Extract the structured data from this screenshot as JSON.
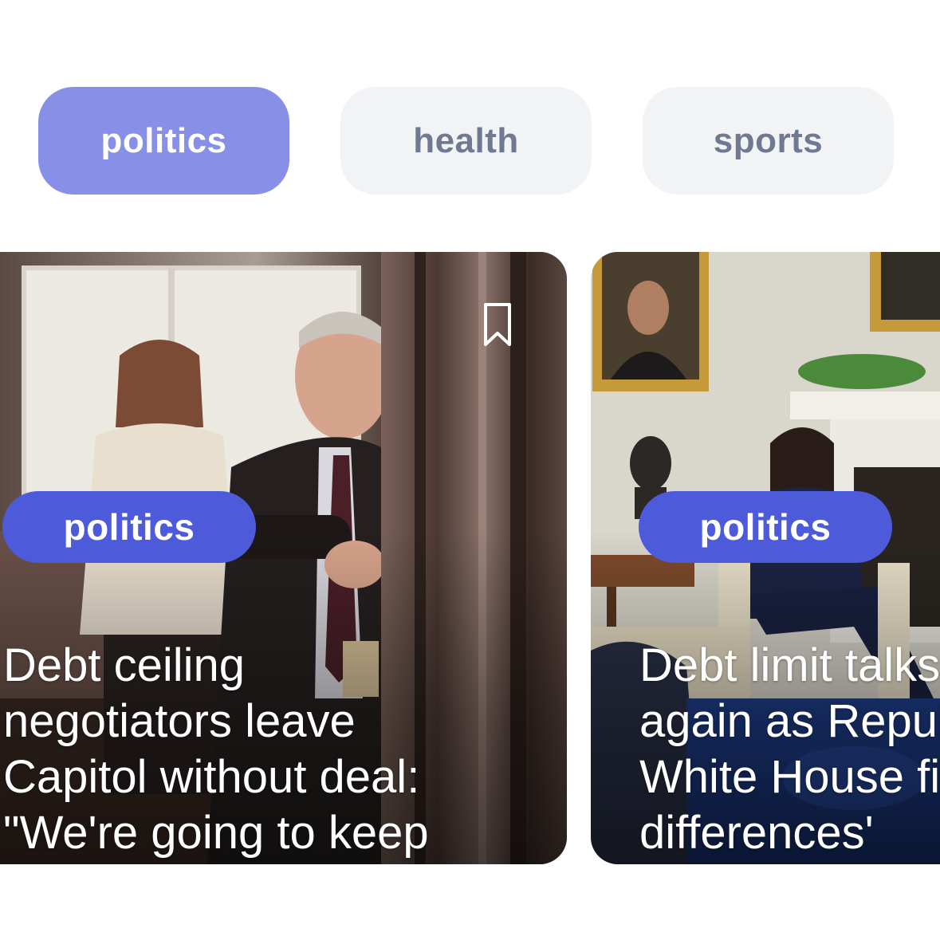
{
  "categories": [
    {
      "label": "politics",
      "active": true
    },
    {
      "label": "health",
      "active": false
    },
    {
      "label": "sports",
      "active": false
    }
  ],
  "articles": [
    {
      "tag": "politics",
      "headline_lines": [
        "Debt ceiling",
        "negotiators leave",
        "Capitol without deal:",
        "\"We're going to keep"
      ],
      "bookmark_icon": "bookmark-outline-icon"
    },
    {
      "tag": "politics",
      "headline_lines": [
        "Debt limit talks",
        "again as Republ",
        "White House fi",
        "differences'"
      ]
    }
  ],
  "colors": {
    "chip_active_bg": "#8790e6",
    "chip_inactive_bg": "#f2f3f5",
    "chip_inactive_text": "#707892",
    "tag_bg": "#4d5bdb"
  }
}
